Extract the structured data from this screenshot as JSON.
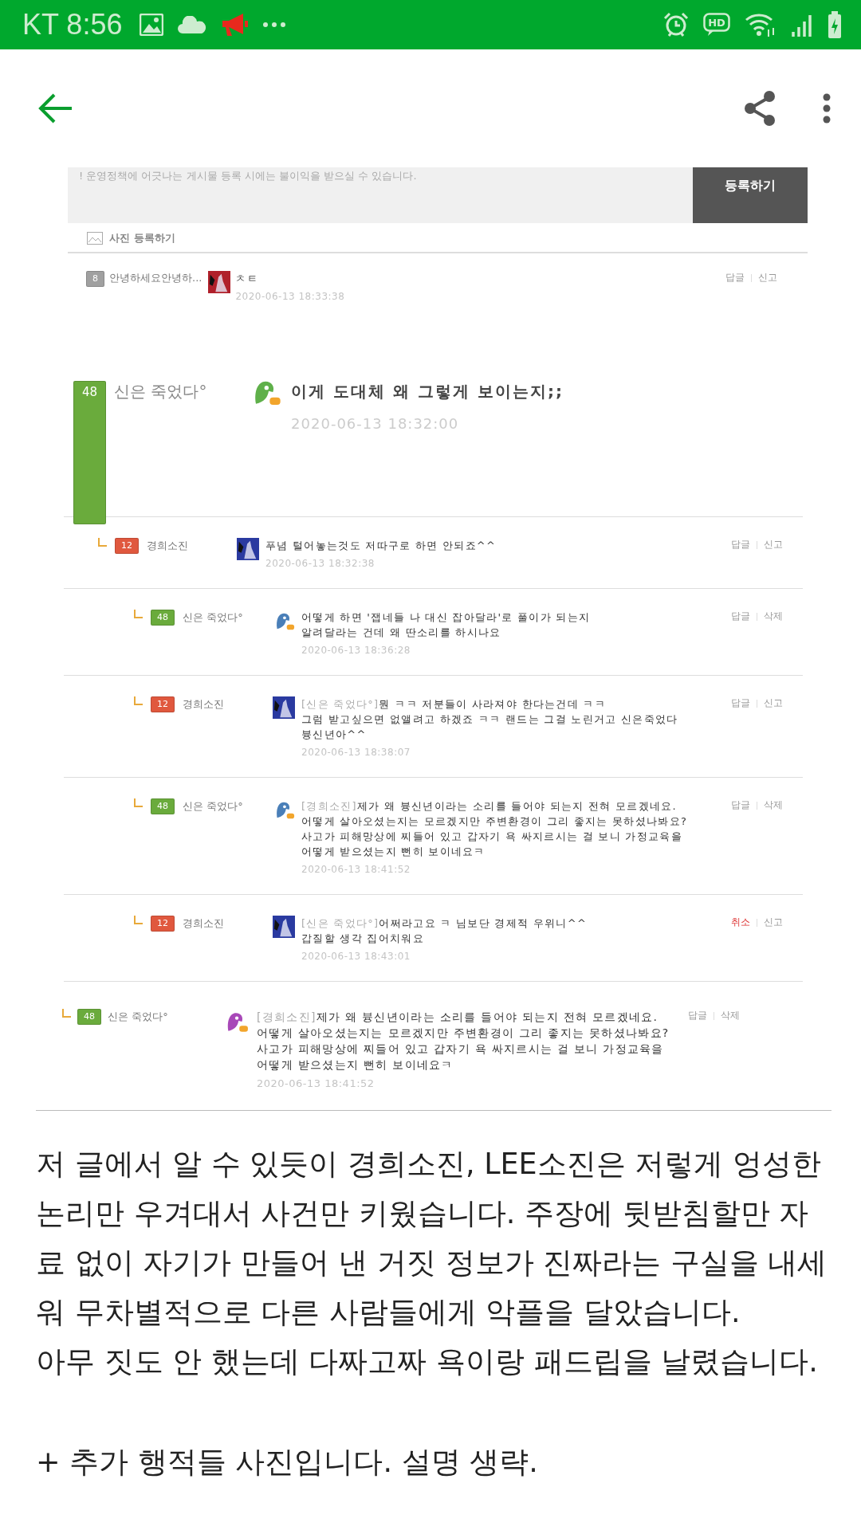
{
  "status_bar": {
    "carrier_time": "KT 8:56",
    "hd_label": "HD"
  },
  "embedded": {
    "notice": "! 운영정책에 어긋나는 게시물 등록 시에는 불이익을 받으실 수 있습니다.",
    "submit_button": "등록하기",
    "photo_link": "사진 등록하기",
    "first_comment": {
      "badge": {
        "text": "8",
        "color": "#a0a0a0"
      },
      "author": "안녕하세요안녕하...",
      "avatar": {
        "kind": "photo",
        "color": "#b0202a"
      },
      "text": "ㅊㅌ",
      "date": "2020-06-13 18:33:38",
      "actions": [
        {
          "label": "답글",
          "kind": "normal"
        },
        {
          "label": "신고",
          "kind": "normal"
        }
      ]
    },
    "thread": {
      "badge": {
        "text": "48",
        "color": "#6aab3c"
      },
      "author": "신은 죽었다°",
      "avatar": {
        "kind": "bird",
        "color": "#5fb04a"
      },
      "text": "이게 도대체 왜 그렇게 보이는지;;",
      "date": "2020-06-13 18:32:00",
      "children": [
        {
          "badge": {
            "text": "12",
            "color": "#e0583e"
          },
          "author": "경희소진",
          "avatar": {
            "kind": "photo",
            "color": "#2a3aa0"
          },
          "text": "푸념 털어놓는것도 저따구로 하면 안되죠^^",
          "date": "2020-06-13 18:32:38",
          "actions": [
            {
              "label": "답글",
              "kind": "normal"
            },
            {
              "label": "신고",
              "kind": "normal"
            }
          ],
          "children": [
            {
              "badge": {
                "text": "48",
                "color": "#6aab3c"
              },
              "author": "신은 죽었다°",
              "avatar": {
                "kind": "bird",
                "color": "#4a7fb8"
              },
              "text": "어떻게 하면 '잽네들 나 대신 잡아달라'로 풀이가 되는지\n알려달라는 건데 왜 딴소리를 하시나요",
              "date": "2020-06-13 18:36:28",
              "actions": [
                {
                  "label": "답글",
                  "kind": "normal"
                },
                {
                  "label": "삭제",
                  "kind": "normal"
                }
              ]
            },
            {
              "badge": {
                "text": "12",
                "color": "#e0583e"
              },
              "author": "경희소진",
              "avatar": {
                "kind": "photo",
                "color": "#2a3aa0"
              },
              "mention": "[신은 죽었다°]",
              "text": "뭔 ㅋㅋ 저분들이 사라져야 한다는건데 ㅋㅋ\n그럼 받고싶으면 없앨려고 하겠죠 ㅋㅋ 랜드는 그걸 노린거고 신은죽었다\n븅신년아^^",
              "date": "2020-06-13 18:38:07",
              "actions": [
                {
                  "label": "답글",
                  "kind": "normal"
                },
                {
                  "label": "신고",
                  "kind": "normal"
                }
              ]
            },
            {
              "badge": {
                "text": "48",
                "color": "#6aab3c"
              },
              "author": "신은 죽었다°",
              "avatar": {
                "kind": "bird",
                "color": "#4a7fb8"
              },
              "mention": "[경희소진]",
              "text": "제가 왜 븅신년이라는 소리를 들어야 되는지 전혀 모르겠네요.\n어떻게 살아오셨는지는 모르겠지만 주변환경이 그리 좋지는 못하셨나봐요?\n사고가 피해망상에 찌들어 있고 갑자기 욕 싸지르시는 걸 보니 가정교육을\n어떻게 받으셨는지 뻔히 보이네요ㅋ",
              "date": "2020-06-13 18:41:52",
              "actions": [
                {
                  "label": "답글",
                  "kind": "normal"
                },
                {
                  "label": "삭제",
                  "kind": "normal"
                }
              ]
            },
            {
              "badge": {
                "text": "12",
                "color": "#e0583e"
              },
              "author": "경희소진",
              "avatar": {
                "kind": "photo",
                "color": "#2a3aa0"
              },
              "mention": "[신은 죽었다°]",
              "text": "어쩌라고요 ㅋ 님보단 경제적 우위니^^\n갑질할 생각 집어치워요",
              "date": "2020-06-13 18:43:01",
              "actions": [
                {
                  "label": "취소",
                  "kind": "danger"
                },
                {
                  "label": "신고",
                  "kind": "normal"
                }
              ]
            }
          ]
        }
      ]
    },
    "extra_reply": {
      "badge": {
        "text": "48",
        "color": "#6aab3c"
      },
      "author": "신은 죽었다°",
      "avatar": {
        "kind": "bird",
        "color": "#a848b8"
      },
      "mention": "[경희소진]",
      "text": "제가 왜 븅신년이라는 소리를 들어야 되는지 전혀 모르겠네요.\n어떻게 살아오셨는지는 모르겠지만 주변환경이 그리 좋지는 못하셨나봐요?\n사고가 피해망상에 찌들어 있고 갑자기 욕 싸지르시는 걸 보니 가정교육을\n어떻게 받으셨는지 뻔히 보이네요ㅋ",
      "date": "2020-06-13 18:41:52",
      "actions": [
        {
          "label": "답글",
          "kind": "normal"
        },
        {
          "label": "삭제",
          "kind": "normal"
        }
      ]
    }
  },
  "article": {
    "paragraphs": [
      "저 글에서 알 수 있듯이 경희소진, LEE소진은 저렇게 엉성한 논리만 우겨대서 사건만 키웠습니다. 주장에 뒷받침할만 자료 없이 자기가 만들어 낸 거짓 정보가 진짜라는 구실을 내세워 무차별적으로 다른 사람들에게 악플을 달았습니다.\n아무 짓도 안 했는데 다짜고짜 욕이랑 패드립을 날렸습니다.",
      "+ 추가 행적들 사진입니다. 설명 생략."
    ]
  }
}
